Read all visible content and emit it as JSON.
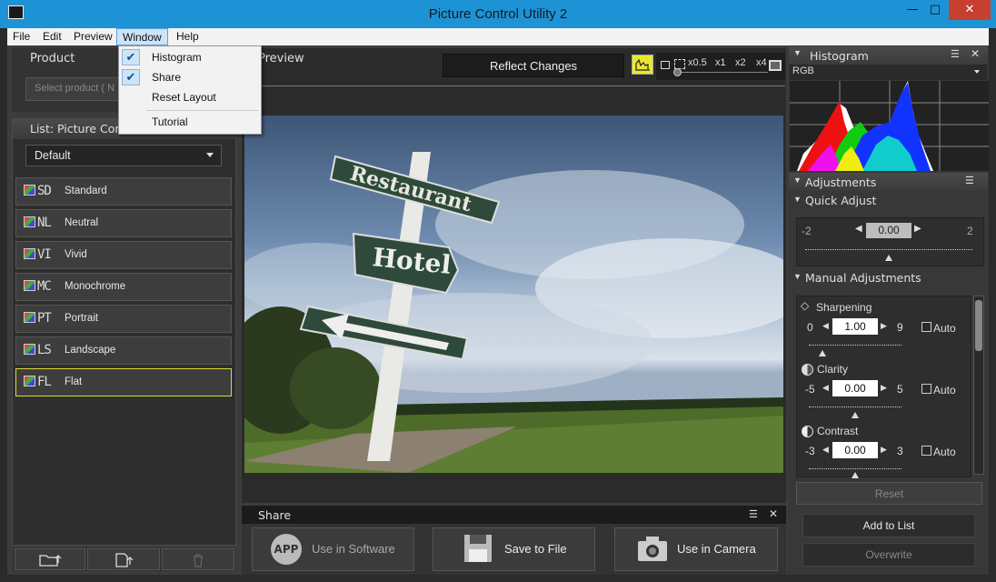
{
  "window": {
    "title": "Picture Control Utility 2",
    "minimize": "—",
    "maximize": "□",
    "close": "✕"
  },
  "menu": {
    "file": "File",
    "edit": "Edit",
    "preview": "Preview",
    "window": "Window",
    "help": "Help"
  },
  "window_menu": {
    "items": [
      {
        "label": "Histogram",
        "checked": true
      },
      {
        "label": "Share",
        "checked": true
      },
      {
        "label": "Reset Layout",
        "checked": false
      },
      {
        "label": "Tutorial",
        "checked": false
      }
    ]
  },
  "product": {
    "title": "Product",
    "placeholder": "Select product ( N"
  },
  "list": {
    "title": "List: Picture Cont",
    "dropdown": "Default",
    "items": [
      {
        "code": "SD",
        "name": "Standard"
      },
      {
        "code": "NL",
        "name": "Neutral"
      },
      {
        "code": "VI",
        "name": "Vivid"
      },
      {
        "code": "MC",
        "name": "Monochrome"
      },
      {
        "code": "PT",
        "name": "Portrait"
      },
      {
        "code": "LS",
        "name": "Landscape"
      },
      {
        "code": "FL",
        "name": "Flat"
      }
    ],
    "selected": "Flat"
  },
  "preview": {
    "title": "Preview",
    "reflect": "Reflect Changes",
    "zoom": [
      "x0.5",
      "x1",
      "x2",
      "x4"
    ]
  },
  "image": {
    "sign_top": "Restaurant",
    "sign_middle": "Hotel"
  },
  "share": {
    "title": "Share",
    "use_software": "Use in Software",
    "app_icon": "APP",
    "save_file": "Save to File",
    "use_camera": "Use in Camera"
  },
  "histogram": {
    "title": "Histogram",
    "channel": "RGB"
  },
  "adjustments": {
    "title": "Adjustments",
    "quick_title": "Quick Adjust",
    "quick": {
      "min": "-2",
      "max": "2",
      "value": "0.00"
    },
    "manual_title": "Manual Adjustments",
    "sharpening": {
      "label": "Sharpening",
      "min": "0",
      "max": "9",
      "value": "1.00",
      "auto": "Auto"
    },
    "clarity": {
      "label": "Clarity",
      "min": "-5",
      "max": "5",
      "value": "0.00",
      "auto": "Auto"
    },
    "contrast": {
      "label": "Contrast",
      "min": "-3",
      "max": "3",
      "value": "0.00",
      "auto": "Auto"
    },
    "reset": "Reset",
    "add_to_list": "Add to List",
    "overwrite": "Overwrite"
  },
  "colors": {
    "titlebar": "#1d93d6",
    "selection": "#d9d93a",
    "accent": "#e8e830"
  }
}
